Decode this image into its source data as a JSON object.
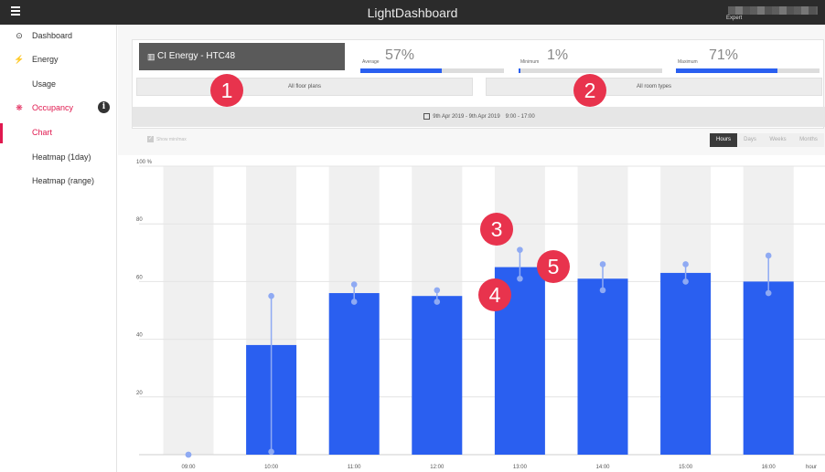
{
  "app": {
    "title": "LightDashboard",
    "user_role": "Expert"
  },
  "sidebar": {
    "items": [
      {
        "label": "Dashboard",
        "icon": "dashboard-icon",
        "glyph": "⊙"
      },
      {
        "label": "Energy",
        "icon": "lightning-icon",
        "glyph": "⚡"
      },
      {
        "label": "Usage"
      },
      {
        "label": "Occupancy",
        "icon": "paw-icon",
        "glyph": "❋"
      },
      {
        "label": "Chart"
      },
      {
        "label": "Heatmap (1day)"
      },
      {
        "label": "Heatmap (range)"
      }
    ],
    "info_glyph": "i"
  },
  "header": {
    "energy_button": "CI Energy - HTC48",
    "building_glyph": "▥",
    "stats": [
      {
        "label": "Average",
        "value": "57%",
        "fraction": 0.57
      },
      {
        "label": "Minimum",
        "value": "1%",
        "fraction": 0.01
      },
      {
        "label": "Maximum",
        "value": "71%",
        "fraction": 0.71
      }
    ],
    "floor_select": "All floor plans",
    "room_select": "All room types",
    "date_range": "9th Apr 2019 - 9th Apr 2019",
    "time_range": "9:00 - 17:00"
  },
  "controls": {
    "checkbox_label": "Show min/max",
    "checkbox_glyph": "✓",
    "segments": [
      "Hours",
      "Days",
      "Weeks",
      "Months"
    ],
    "selected": "Hours"
  },
  "chart_data": {
    "type": "bar",
    "categories": [
      "09:00",
      "10:00",
      "11:00",
      "12:00",
      "13:00",
      "14:00",
      "15:00",
      "16:00"
    ],
    "values": [
      0,
      38,
      56,
      55,
      65,
      61,
      63,
      60
    ],
    "min": [
      0,
      1,
      53,
      53,
      61,
      57,
      60,
      56
    ],
    "max": [
      0,
      55,
      59,
      57,
      71,
      66,
      66,
      69
    ],
    "ylim": [
      0,
      100
    ],
    "yticks": [
      "100 %",
      "80",
      "60",
      "40",
      "20"
    ],
    "xlabel": "hour",
    "colors": {
      "bar": "#2a5ff0",
      "whisker": "#8faaf3",
      "band": "#f0f0f0"
    }
  },
  "callouts": [
    "1",
    "2",
    "3",
    "4",
    "5"
  ]
}
